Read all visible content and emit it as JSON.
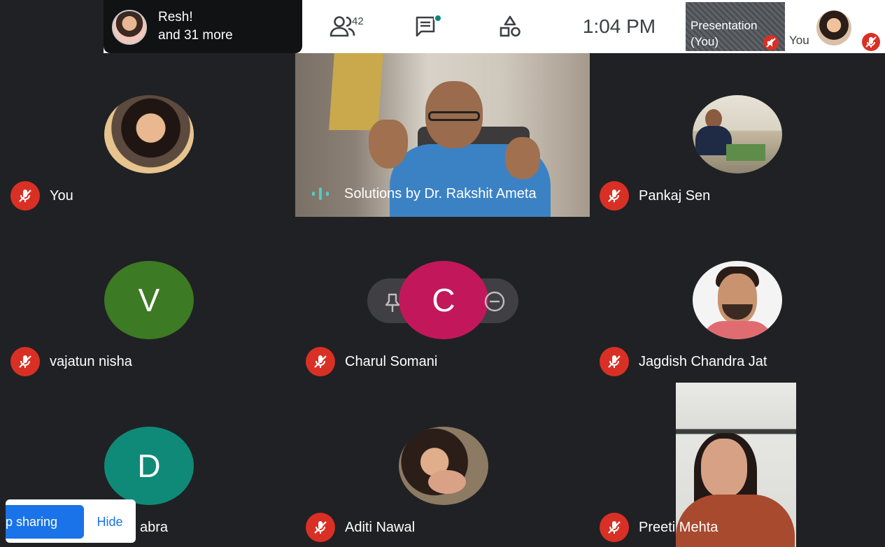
{
  "topbar": {
    "participant_preview_name": "Resh!",
    "participant_preview_more": "and 31 more",
    "people_count": "42",
    "clock": "1:04  PM",
    "presentation_label": "Presentation (You)",
    "self_label": "You",
    "icons": [
      "people-icon",
      "chat-icon",
      "activities-icon"
    ]
  },
  "tiles": [
    {
      "name": "You",
      "muted": true,
      "avatar": "photo"
    },
    {
      "name": "Solutions by Dr. Rakshit Ameta",
      "speaking": true,
      "avatar": "video"
    },
    {
      "name": "Pankaj Sen",
      "muted": true,
      "avatar": "photo"
    },
    {
      "name": "vajatun nisha",
      "muted": true,
      "avatar": "letter",
      "letter": "V",
      "color": "#3c7a23"
    },
    {
      "name": "Charul Somani",
      "muted": true,
      "avatar": "letter",
      "letter": "C",
      "color": "#c2185b"
    },
    {
      "name": "Jagdish Chandra Jat",
      "muted": true,
      "avatar": "photo"
    },
    {
      "name": "abra",
      "muted": true,
      "avatar": "letter",
      "letter": "D",
      "color": "#0f8a78"
    },
    {
      "name": "Aditi Nawal",
      "muted": true,
      "avatar": "photo"
    },
    {
      "name": "Preeti Mehta",
      "muted": true,
      "avatar": "video"
    }
  ],
  "share_bar": {
    "stop_label": "p sharing",
    "hide_label": "Hide"
  },
  "colors": {
    "background": "#202124",
    "mute_red": "#d93025",
    "accent_blue": "#1a73e8",
    "speaking_teal": "#4ecdc4"
  }
}
